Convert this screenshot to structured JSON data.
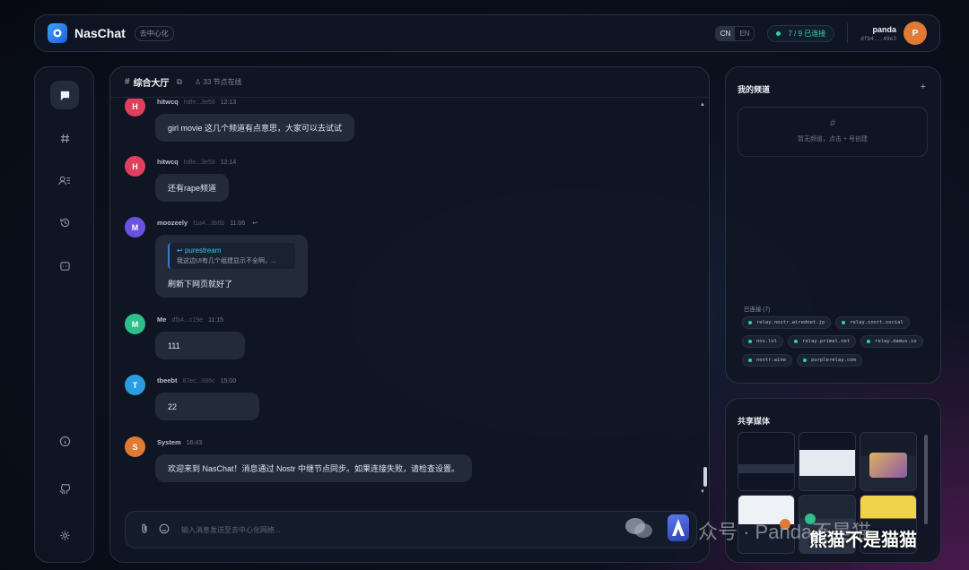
{
  "header": {
    "app_title": "NasChat",
    "tag": "去中心化",
    "lang_cn": "CN",
    "lang_en": "EN",
    "connection_status": "7 / 9 已连接",
    "user_name": "panda",
    "user_id": "dfb4...49e3",
    "user_initial": "P"
  },
  "sidebar": {
    "items": [
      "chat-icon",
      "hash-icon",
      "users-icon",
      "history-icon",
      "bot-icon",
      "info-icon",
      "github-icon",
      "settings-icon"
    ]
  },
  "chat": {
    "channel_hash": "#",
    "channel_name": "综合大厅",
    "online": "33 节点在线",
    "messages": [
      {
        "initial": "H",
        "name": "hitwcq",
        "pubkey": "hdfe...3e58",
        "time": "12:13",
        "text": "girl movie 这几个频道有点意思，大家可以去试试",
        "color": "#e0405e"
      },
      {
        "initial": "H",
        "name": "hitwcq",
        "pubkey": "hdfe...3e58",
        "time": "12:14",
        "text": "还有rape频道",
        "color": "#e0405e"
      },
      {
        "initial": "M",
        "name": "moozeely",
        "pubkey": "f1a4...3b6b",
        "time": "11:06",
        "text": "刷新下网页就好了",
        "color": "#6a52e0",
        "quote_name": "purestream",
        "quote_text": "我这边UI有几个组建显示不全啊，..."
      },
      {
        "initial": "M",
        "name": "Me",
        "pubkey": "dfb4...c19e",
        "time": "11:15",
        "text": "111",
        "color": "#2dbf8c"
      },
      {
        "initial": "T",
        "name": "tbeebt",
        "pubkey": "87ec...086c",
        "time": "15:00",
        "text": "22",
        "color": "#2a9de0"
      },
      {
        "initial": "S",
        "name": "System",
        "pubkey": "",
        "time": "16:43",
        "text": "欢迎来到 NasChat！消息通过 Nostr 中继节点同步。如果连接失败，请检查设置。",
        "color": "#e07a34"
      }
    ],
    "composer_placeholder": "输入消息发送至去中心化网络..."
  },
  "channels": {
    "title": "我的频道",
    "add": "+",
    "empty_icon": "#",
    "empty_text": "暂无频道，点击 + 号创建",
    "relays_label": "已连接 (7)",
    "relays": [
      "relay.nostr.wirednet.jp",
      "relay.snort.social",
      "nos.lol",
      "relay.primal.net",
      "relay.damus.io",
      "nostr.wine",
      "purplerelay.com"
    ]
  },
  "media": {
    "title": "共享媒体"
  },
  "watermark": {
    "text": "众号 · Panda不是猫",
    "tag": "熊猫不是猫猫"
  },
  "colors": {
    "accent": "#2fd39c",
    "avatar_user": "#e07a34",
    "bubble": "#232a3a"
  }
}
